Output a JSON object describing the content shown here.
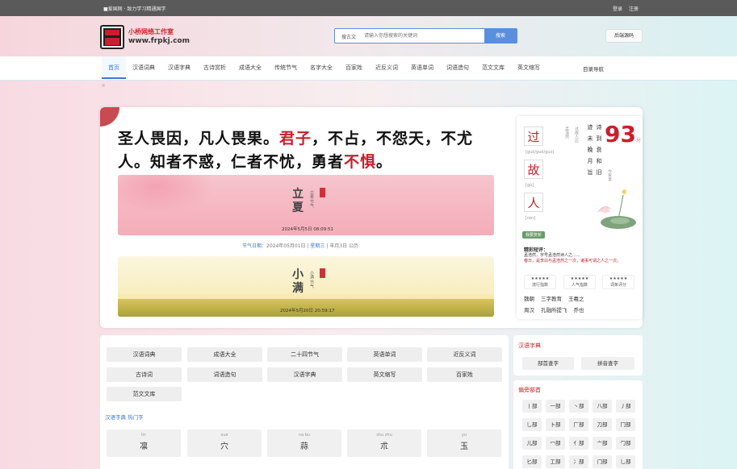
{
  "topbar": {
    "left": "■爱国网 · 致力学习精通国学",
    "login": "登录",
    "register": "注册"
  },
  "header": {
    "brand": "小桥网络工作室",
    "url": "www.frpkj.com",
    "logo_text": "小桥网络",
    "search_select": "搜古文",
    "search_placeholder": "请输入你想搜索的关键词",
    "search_button": "搜索",
    "right_button": "后端源码"
  },
  "nav": {
    "items": [
      "首页",
      "汉语词典",
      "汉语字典",
      "古诗赏析",
      "成语大全",
      "传统节气",
      "名字大全",
      "百家姓",
      "近反义词",
      "英语单词",
      "词语造句",
      "范文文库",
      "英文缩写"
    ],
    "right": "目录导航"
  },
  "hero": {
    "quote_1": "圣人畏因，凡人畏果。",
    "quote_red1": "君子",
    "quote_2": "，不占，不怨天，不尤人。知者不惑，仁者不忧，勇者",
    "quote_red2": "不惧",
    "quote_3": "。",
    "term1": "立夏",
    "term1_sub": "立夏·节气",
    "term1_date": "2024年5月5日 08:09:51",
    "middle_label": "节气日期：",
    "middle_value": "2024年05月01日",
    "middle_sep": " | ",
    "middle_label2": "星期三",
    "middle_tail": " | 丰月3日 公历",
    "term2": "小满",
    "term2_sub": "小满·节气",
    "term2_date": "2024年5月20日 20:59:17"
  },
  "card": {
    "chars": [
      {
        "h": "过",
        "p": "[guò/guō/guo]"
      },
      {
        "h": "故",
        "p": "[gù]"
      },
      {
        "h": "人",
        "p": "[rén]"
      }
    ],
    "score": "93",
    "score_unit": "分",
    "poem_cols": [
      "迹",
      "诗",
      "未",
      "到",
      "晚",
      "衰",
      "月",
      "和",
      "旨",
      "旧"
    ],
    "small_cols": [
      "孟浩然",
      "过故人庄",
      "今宵事"
    ],
    "tag": "我要赏析",
    "comment_title": "精彩短评：",
    "comment_1": "孟浩然，字号孟浩然诗人之......",
    "comment_2": "春日，是李白与孟浩然之一次，诸事可谓之人之一次。",
    "stats": [
      {
        "stars": "★★★★★",
        "label": "流行指数"
      },
      {
        "stars": "★★★★★",
        "label": "人气指数"
      },
      {
        "stars": "★★★★★",
        "label": "词条评分"
      }
    ],
    "links_1": [
      "魏朝",
      "三字教育",
      "王羲之"
    ],
    "links_2": [
      "周汉",
      "孔融所提飞",
      "乔也"
    ]
  },
  "cats": {
    "buttons": [
      "汉语词典",
      "成语大全",
      "二十四节气",
      "英语单词",
      "近反义词",
      "古诗词",
      "词语造句",
      "汉语字典",
      "英文缩写",
      "百家姓",
      "范文文库"
    ],
    "hot_label": "汉语字典 热门字",
    "hot": [
      {
        "p": "lin",
        "h": "凛"
      },
      {
        "p": "xue",
        "h": "穴"
      },
      {
        "p": "na bu",
        "h": "蒜"
      },
      {
        "p": "shu zhu",
        "h": "朮"
      },
      {
        "p": "yu",
        "h": "玉"
      }
    ]
  },
  "side": {
    "dict_title": "汉语字典",
    "dict_btns": [
      "部首查字",
      "拼音查字"
    ],
    "radicals_title": "偏旁部首",
    "radicals": [
      "丨部",
      "一部",
      "丶部",
      "八部",
      "丿部",
      "乚部",
      "卜部",
      "厂部",
      "刀部",
      "冂部",
      "儿部",
      "冖部",
      "亻部",
      "亠部",
      "勹部",
      "匕部",
      "工部",
      "冫部",
      "门部",
      "乚部"
    ]
  }
}
